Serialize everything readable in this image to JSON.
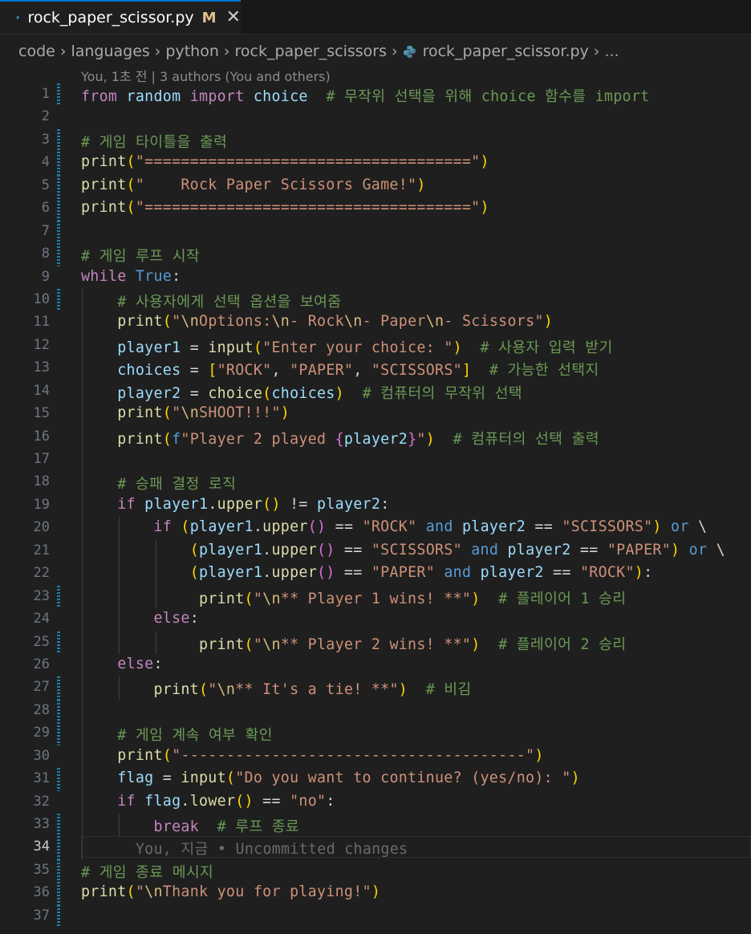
{
  "tab": {
    "filename": "rock_paper_scissor.py",
    "status": "M",
    "close": "✕"
  },
  "breadcrumb": [
    "code",
    "languages",
    "python",
    "rock_paper_scissors",
    "rock_paper_scissor.py",
    "..."
  ],
  "blame_header": "You, 1초 전 | 3 authors (You and others)",
  "colors": {
    "tab_accent": "#0078d4",
    "modified_gutter": "#1b81a8",
    "modified_letter": "#e2c08d"
  },
  "lines": [
    {
      "n": "1",
      "gutter": true,
      "tokens": [
        [
          "kw",
          "from"
        ],
        [
          "",
          "",
          " "
        ],
        [
          "var",
          "random"
        ],
        [
          "",
          " "
        ],
        [
          "kw",
          "import"
        ],
        [
          "",
          " "
        ],
        [
          "var",
          "choice"
        ],
        [
          "",
          "  "
        ],
        [
          "cm",
          "# 무작위 선택을 위해 choice 함수를 import"
        ]
      ]
    },
    {
      "n": "2",
      "gutter": false,
      "tokens": []
    },
    {
      "n": "3",
      "gutter": true,
      "tokens": [
        [
          "cm",
          "# 게임 타이틀을 출력"
        ]
      ]
    },
    {
      "n": "4",
      "gutter": true,
      "tokens": [
        [
          "fn",
          "print"
        ],
        [
          "br1",
          "("
        ],
        [
          "str",
          "\"====================================\""
        ],
        [
          "br1",
          ")"
        ]
      ]
    },
    {
      "n": "5",
      "gutter": true,
      "tokens": [
        [
          "fn",
          "print"
        ],
        [
          "br1",
          "("
        ],
        [
          "str",
          "\"    Rock Paper Scissors Game!\""
        ],
        [
          "br1",
          ")"
        ]
      ]
    },
    {
      "n": "6",
      "gutter": true,
      "tokens": [
        [
          "fn",
          "print"
        ],
        [
          "br1",
          "("
        ],
        [
          "str",
          "\"====================================\""
        ],
        [
          "br1",
          ")"
        ]
      ]
    },
    {
      "n": "7",
      "gutter": true,
      "tokens": []
    },
    {
      "n": "8",
      "gutter": true,
      "tokens": [
        [
          "cm",
          "# 게임 루프 시작"
        ]
      ]
    },
    {
      "n": "9",
      "gutter": false,
      "tokens": [
        [
          "kw",
          "while"
        ],
        [
          "",
          " "
        ],
        [
          "bool",
          "True"
        ],
        [
          "",
          ":"
        ]
      ]
    },
    {
      "n": "10",
      "gutter": true,
      "indent": 1,
      "tokens": [
        [
          "",
          "    "
        ],
        [
          "cm",
          "# 사용자에게 선택 옵션을 보여줌"
        ]
      ]
    },
    {
      "n": "11",
      "gutter": false,
      "indent": 1,
      "tokens": [
        [
          "",
          "    "
        ],
        [
          "fn",
          "print"
        ],
        [
          "br1",
          "("
        ],
        [
          "str",
          "\""
        ],
        [
          "esc",
          "\\n"
        ],
        [
          "str",
          "Options:"
        ],
        [
          "esc",
          "\\n"
        ],
        [
          "str",
          "- Rock"
        ],
        [
          "esc",
          "\\n"
        ],
        [
          "str",
          "- Paper"
        ],
        [
          "esc",
          "\\n"
        ],
        [
          "str",
          "- Scissors\""
        ],
        [
          "br1",
          ")"
        ]
      ]
    },
    {
      "n": "12",
      "gutter": false,
      "indent": 1,
      "tokens": [
        [
          "",
          "    "
        ],
        [
          "var",
          "player1"
        ],
        [
          "",
          " = "
        ],
        [
          "fn",
          "input"
        ],
        [
          "br1",
          "("
        ],
        [
          "str",
          "\"Enter your choice: \""
        ],
        [
          "br1",
          ")"
        ],
        [
          "",
          "  "
        ],
        [
          "cm",
          "# 사용자 입력 받기"
        ]
      ]
    },
    {
      "n": "13",
      "gutter": false,
      "indent": 1,
      "tokens": [
        [
          "",
          "    "
        ],
        [
          "var",
          "choices"
        ],
        [
          "",
          " = "
        ],
        [
          "br1",
          "["
        ],
        [
          "str",
          "\"ROCK\""
        ],
        [
          "",
          ", "
        ],
        [
          "str",
          "\"PAPER\""
        ],
        [
          "",
          ", "
        ],
        [
          "str",
          "\"SCISSORS\""
        ],
        [
          "br1",
          "]"
        ],
        [
          "",
          "  "
        ],
        [
          "cm",
          "# 가능한 선택지"
        ]
      ]
    },
    {
      "n": "14",
      "gutter": false,
      "indent": 1,
      "tokens": [
        [
          "",
          "    "
        ],
        [
          "var",
          "player2"
        ],
        [
          "",
          " = "
        ],
        [
          "fn",
          "choice"
        ],
        [
          "br1",
          "("
        ],
        [
          "var",
          "choices"
        ],
        [
          "br1",
          ")"
        ],
        [
          "",
          "  "
        ],
        [
          "cm",
          "# 컴퓨터의 무작위 선택"
        ]
      ]
    },
    {
      "n": "15",
      "gutter": false,
      "indent": 1,
      "tokens": [
        [
          "",
          "    "
        ],
        [
          "fn",
          "print"
        ],
        [
          "br1",
          "("
        ],
        [
          "str",
          "\""
        ],
        [
          "esc",
          "\\n"
        ],
        [
          "str",
          "SHOOT!!!\""
        ],
        [
          "br1",
          ")"
        ]
      ]
    },
    {
      "n": "16",
      "gutter": false,
      "indent": 1,
      "tokens": [
        [
          "",
          "    "
        ],
        [
          "fn",
          "print"
        ],
        [
          "br1",
          "("
        ],
        [
          "bool",
          "f"
        ],
        [
          "str",
          "\"Player 2 played "
        ],
        [
          "br2",
          "{"
        ],
        [
          "var",
          "player2"
        ],
        [
          "br2",
          "}"
        ],
        [
          "str",
          "\""
        ],
        [
          "br1",
          ")"
        ],
        [
          "",
          "  "
        ],
        [
          "cm",
          "# 컴퓨터의 선택 출력"
        ]
      ]
    },
    {
      "n": "17",
      "gutter": false,
      "indent": 1,
      "tokens": []
    },
    {
      "n": "18",
      "gutter": false,
      "indent": 1,
      "tokens": [
        [
          "",
          "    "
        ],
        [
          "cm",
          "# 승패 결정 로직"
        ]
      ]
    },
    {
      "n": "19",
      "gutter": false,
      "indent": 1,
      "tokens": [
        [
          "",
          "    "
        ],
        [
          "kw",
          "if"
        ],
        [
          "",
          " "
        ],
        [
          "var",
          "player1"
        ],
        [
          "",
          "."
        ],
        [
          "fn",
          "upper"
        ],
        [
          "br1",
          "()"
        ],
        [
          "",
          " != "
        ],
        [
          "var",
          "player2"
        ],
        [
          "",
          ":"
        ]
      ]
    },
    {
      "n": "20",
      "gutter": false,
      "indent": 2,
      "tokens": [
        [
          "",
          "        "
        ],
        [
          "kw",
          "if"
        ],
        [
          "",
          " "
        ],
        [
          "br1",
          "("
        ],
        [
          "var",
          "player1"
        ],
        [
          "",
          "."
        ],
        [
          "fn",
          "upper"
        ],
        [
          "br2",
          "()"
        ],
        [
          "",
          " == "
        ],
        [
          "str",
          "\"ROCK\""
        ],
        [
          "",
          " "
        ],
        [
          "bool",
          "and"
        ],
        [
          "",
          " "
        ],
        [
          "var",
          "player2"
        ],
        [
          "",
          " == "
        ],
        [
          "str",
          "\"SCISSORS\""
        ],
        [
          "br1",
          ")"
        ],
        [
          "",
          " "
        ],
        [
          "bool",
          "or"
        ],
        [
          "",
          " \\"
        ]
      ]
    },
    {
      "n": "21",
      "gutter": false,
      "indent": 3,
      "tokens": [
        [
          "",
          "            "
        ],
        [
          "br1",
          "("
        ],
        [
          "var",
          "player1"
        ],
        [
          "",
          "."
        ],
        [
          "fn",
          "upper"
        ],
        [
          "br2",
          "()"
        ],
        [
          "",
          " == "
        ],
        [
          "str",
          "\"SCISSORS\""
        ],
        [
          "",
          " "
        ],
        [
          "bool",
          "and"
        ],
        [
          "",
          " "
        ],
        [
          "var",
          "player2"
        ],
        [
          "",
          " == "
        ],
        [
          "str",
          "\"PAPER\""
        ],
        [
          "br1",
          ")"
        ],
        [
          "",
          " "
        ],
        [
          "bool",
          "or"
        ],
        [
          "",
          " \\"
        ]
      ]
    },
    {
      "n": "22",
      "gutter": false,
      "indent": 3,
      "tokens": [
        [
          "",
          "            "
        ],
        [
          "br1",
          "("
        ],
        [
          "var",
          "player1"
        ],
        [
          "",
          "."
        ],
        [
          "fn",
          "upper"
        ],
        [
          "br2",
          "()"
        ],
        [
          "",
          " == "
        ],
        [
          "str",
          "\"PAPER\""
        ],
        [
          "",
          " "
        ],
        [
          "bool",
          "and"
        ],
        [
          "",
          " "
        ],
        [
          "var",
          "player2"
        ],
        [
          "",
          " == "
        ],
        [
          "str",
          "\"ROCK\""
        ],
        [
          "br1",
          ")"
        ],
        [
          "",
          ":"
        ]
      ]
    },
    {
      "n": "23",
      "gutter": true,
      "indent": 3,
      "tokens": [
        [
          "",
          "             "
        ],
        [
          "fn",
          "print"
        ],
        [
          "br1",
          "("
        ],
        [
          "str",
          "\""
        ],
        [
          "esc",
          "\\n"
        ],
        [
          "str",
          "** Player 1 wins! **\""
        ],
        [
          "br1",
          ")"
        ],
        [
          "",
          "  "
        ],
        [
          "cm",
          "# 플레이어 1 승리"
        ]
      ]
    },
    {
      "n": "24",
      "gutter": false,
      "indent": 2,
      "tokens": [
        [
          "",
          "        "
        ],
        [
          "kw",
          "else"
        ],
        [
          "",
          ":"
        ]
      ]
    },
    {
      "n": "25",
      "gutter": true,
      "indent": 3,
      "tokens": [
        [
          "",
          "             "
        ],
        [
          "fn",
          "print"
        ],
        [
          "br1",
          "("
        ],
        [
          "str",
          "\""
        ],
        [
          "esc",
          "\\n"
        ],
        [
          "str",
          "** Player 2 wins! **\""
        ],
        [
          "br1",
          ")"
        ],
        [
          "",
          "  "
        ],
        [
          "cm",
          "# 플레이어 2 승리"
        ]
      ]
    },
    {
      "n": "26",
      "gutter": false,
      "indent": 1,
      "tokens": [
        [
          "",
          "    "
        ],
        [
          "kw",
          "else"
        ],
        [
          "",
          ":"
        ]
      ]
    },
    {
      "n": "27",
      "gutter": true,
      "indent": 2,
      "tokens": [
        [
          "",
          "        "
        ],
        [
          "fn",
          "print"
        ],
        [
          "br1",
          "("
        ],
        [
          "str",
          "\""
        ],
        [
          "esc",
          "\\n"
        ],
        [
          "str",
          "** It's a tie! **\""
        ],
        [
          "br1",
          ")"
        ],
        [
          "",
          "  "
        ],
        [
          "cm",
          "# 비김"
        ]
      ]
    },
    {
      "n": "28",
      "gutter": true,
      "indent": 1,
      "tokens": []
    },
    {
      "n": "29",
      "gutter": true,
      "indent": 1,
      "tokens": [
        [
          "",
          "    "
        ],
        [
          "cm",
          "# 게임 계속 여부 확인"
        ]
      ]
    },
    {
      "n": "30",
      "gutter": false,
      "indent": 1,
      "tokens": [
        [
          "",
          "    "
        ],
        [
          "fn",
          "print"
        ],
        [
          "br1",
          "("
        ],
        [
          "str",
          "\"--------------------------------------\""
        ],
        [
          "br1",
          ")"
        ]
      ]
    },
    {
      "n": "31",
      "gutter": true,
      "indent": 1,
      "tokens": [
        [
          "",
          "    "
        ],
        [
          "var",
          "flag"
        ],
        [
          "",
          " = "
        ],
        [
          "fn",
          "input"
        ],
        [
          "br1",
          "("
        ],
        [
          "str",
          "\"Do you want to continue? (yes/no): \""
        ],
        [
          "br1",
          ")"
        ]
      ]
    },
    {
      "n": "32",
      "gutter": false,
      "indent": 1,
      "tokens": [
        [
          "",
          "    "
        ],
        [
          "kw",
          "if"
        ],
        [
          "",
          " "
        ],
        [
          "var",
          "flag"
        ],
        [
          "",
          "."
        ],
        [
          "fn",
          "lower"
        ],
        [
          "br1",
          "()"
        ],
        [
          "",
          " == "
        ],
        [
          "str",
          "\"no\""
        ],
        [
          "",
          ":"
        ]
      ]
    },
    {
      "n": "33",
      "gutter": true,
      "indent": 2,
      "tokens": [
        [
          "",
          "        "
        ],
        [
          "kw",
          "break"
        ],
        [
          "",
          "  "
        ],
        [
          "cm",
          "# 루프 종료"
        ]
      ]
    },
    {
      "n": "34",
      "gutter": true,
      "active": true,
      "indent": 1,
      "tokens": [
        [
          "",
          "      "
        ],
        [
          "ghost",
          "You, 지금 • Uncommitted changes"
        ]
      ]
    },
    {
      "n": "35",
      "gutter": true,
      "tokens": [
        [
          "cm",
          "# 게임 종료 메시지"
        ]
      ]
    },
    {
      "n": "36",
      "gutter": true,
      "tokens": [
        [
          "fn",
          "print"
        ],
        [
          "br1",
          "("
        ],
        [
          "str",
          "\""
        ],
        [
          "esc",
          "\\n"
        ],
        [
          "str",
          "Thank you for playing!\""
        ],
        [
          "br1",
          ")"
        ]
      ]
    },
    {
      "n": "37",
      "gutter": true,
      "tokens": []
    }
  ]
}
